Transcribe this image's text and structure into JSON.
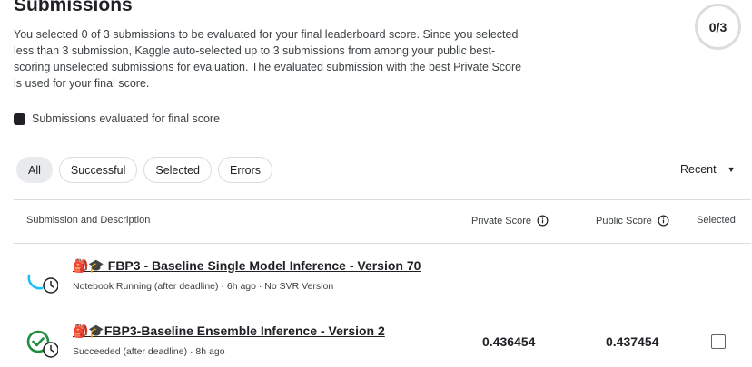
{
  "header": {
    "title": "Submissions",
    "description": "You selected 0 of 3 submissions to be evaluated for your final leaderboard score. Since you selected less than 3 submission, Kaggle auto-selected up to 3 submissions from among your public best-scoring unselected submissions for evaluation. The evaluated submission with the best Private Score is used for your final score.",
    "counter": "0/3"
  },
  "legend": {
    "label": "Submissions evaluated for final score"
  },
  "filters": [
    {
      "label": "All",
      "active": true
    },
    {
      "label": "Successful",
      "active": false
    },
    {
      "label": "Selected",
      "active": false
    },
    {
      "label": "Errors",
      "active": false
    }
  ],
  "sort": {
    "label": "Recent"
  },
  "table": {
    "headers": {
      "submission": "Submission and Description",
      "private": "Private Score",
      "public": "Public Score",
      "selected": "Selected"
    },
    "rows": [
      {
        "emoji": "🎒🎓",
        "title": " FBP3 - Baseline Single Model Inference - Version 70",
        "subtitle": "Notebook Running (after deadline) · 6h ago · No SVR Version",
        "status": "running",
        "private_score": "",
        "public_score": ""
      },
      {
        "emoji": "🎒🎓",
        "title": "FBP3-Baseline Ensemble Inference - Version 2",
        "subtitle": "Succeeded (after deadline) · 8h ago",
        "status": "succeeded",
        "private_score": "0.436454",
        "public_score": "0.437454"
      }
    ]
  },
  "colors": {
    "running": "#20beff",
    "succeeded": "#1e8e3e",
    "text": "#202124"
  }
}
